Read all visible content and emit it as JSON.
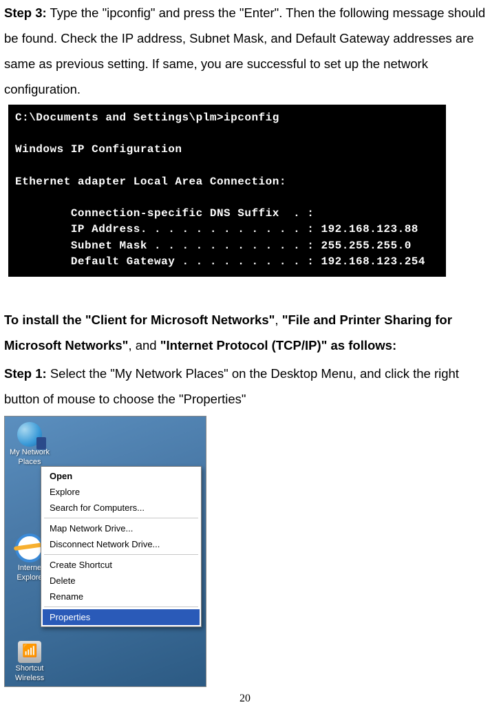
{
  "step3": {
    "label": "Step 3:",
    "text": " Type the \"ipconfig\" and press the \"Enter\". Then the following message should be found. Check the IP address, Subnet Mask, and Default Gateway addresses are same as previous setting. If same, you are successful to set up the network configuration."
  },
  "cmd": {
    "prompt_line": "C:\\Documents and Settings\\plm>ipconfig",
    "title_line": "Windows IP Configuration",
    "adapter_line": "Ethernet adapter Local Area Connection:",
    "dns_line": "        Connection-specific DNS Suffix  . :",
    "ip_line": "        IP Address. . . . . . . . . . . . : 192.168.123.88",
    "mask_line": "        Subnet Mask . . . . . . . . . . . : 255.255.255.0",
    "gw_line": "        Default Gateway . . . . . . . . . : 192.168.123.254"
  },
  "install": {
    "lead": "To install the ",
    "b1": "\"Client for Microsoft Networks\"",
    "sep1": ", ",
    "b2": "\"File and Printer Sharing for Microsoft Networks\"",
    "sep2": ", and ",
    "b3": "\"Internet Protocol (TCP/IP)\" as follows:"
  },
  "step1": {
    "label": "Step 1:",
    "text": " Select the \"My Network Places\" on the Desktop Menu, and click the right button of mouse to choose the \"Properties\""
  },
  "desktop": {
    "icon1_line1": "My Network",
    "icon1_line2": "Places",
    "icon2_line1": "Interne",
    "icon2_line2": "Explore",
    "icon3_line1": "Shortcut",
    "icon3_line2": "Wireless"
  },
  "menu": {
    "open": "Open",
    "explore": "Explore",
    "search": "Search for Computers...",
    "map": "Map Network Drive...",
    "disconnect": "Disconnect Network Drive...",
    "createsc": "Create Shortcut",
    "delete": "Delete",
    "rename": "Rename",
    "properties": "Properties"
  },
  "pagenum": "20"
}
